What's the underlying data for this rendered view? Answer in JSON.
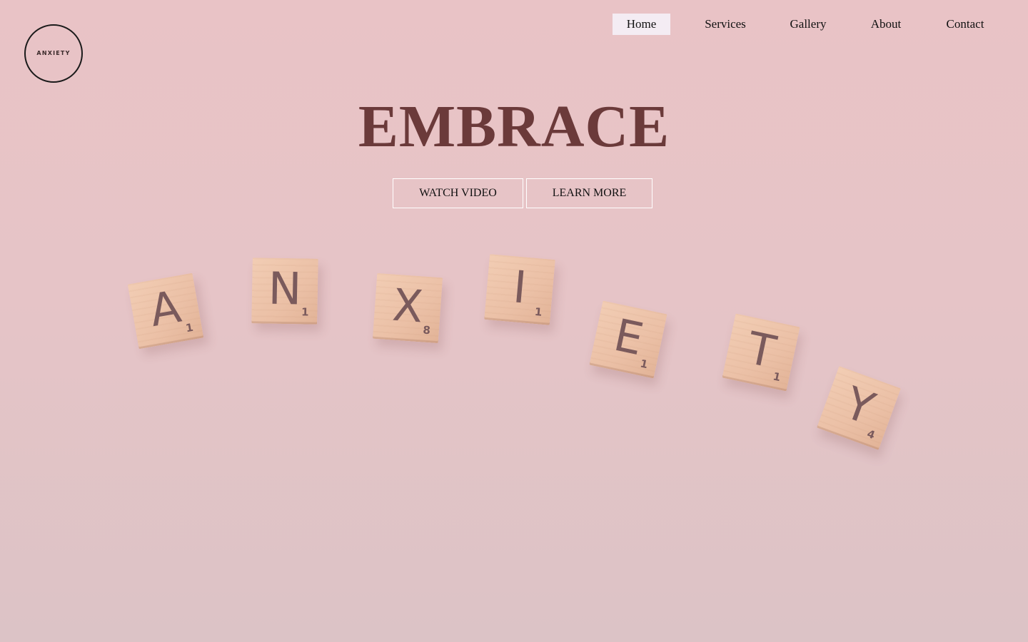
{
  "logo": {
    "text": "ANXIETY"
  },
  "nav": {
    "items": [
      {
        "label": "Home",
        "active": true
      },
      {
        "label": "Services",
        "active": false
      },
      {
        "label": "Gallery",
        "active": false
      },
      {
        "label": "About",
        "active": false
      },
      {
        "label": "Contact",
        "active": false
      }
    ]
  },
  "hero": {
    "headline": "EMBRACE",
    "buttons": {
      "watch_video": "WATCH VIDEO",
      "learn_more": "LEARN MORE"
    },
    "tiles": [
      {
        "letter": "A",
        "score": "1"
      },
      {
        "letter": "N",
        "score": "1"
      },
      {
        "letter": "X",
        "score": "8"
      },
      {
        "letter": "I",
        "score": "1"
      },
      {
        "letter": "E",
        "score": "1"
      },
      {
        "letter": "T",
        "score": "1"
      },
      {
        "letter": "Y",
        "score": "4"
      }
    ]
  },
  "colors": {
    "background": "#e9c3c6",
    "headline": "#6b3a3a",
    "nav_active_bg": "#f4ecf3",
    "tile_wood": "#ebc0a6",
    "tile_ink": "#7a5a5c"
  }
}
